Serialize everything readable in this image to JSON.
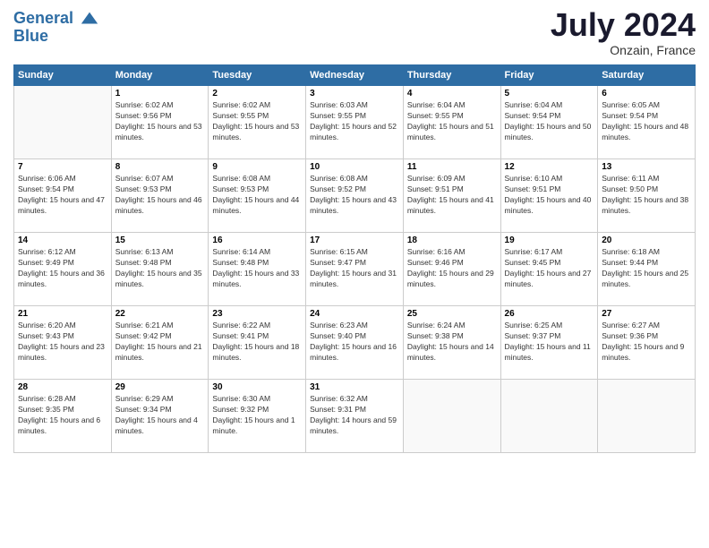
{
  "logo": {
    "line1": "General",
    "line2": "Blue"
  },
  "title": "July 2024",
  "location": "Onzain, France",
  "headers": [
    "Sunday",
    "Monday",
    "Tuesday",
    "Wednesday",
    "Thursday",
    "Friday",
    "Saturday"
  ],
  "weeks": [
    [
      {
        "day": "",
        "sunrise": "",
        "sunset": "",
        "daylight": ""
      },
      {
        "day": "1",
        "sunrise": "Sunrise: 6:02 AM",
        "sunset": "Sunset: 9:56 PM",
        "daylight": "Daylight: 15 hours and 53 minutes."
      },
      {
        "day": "2",
        "sunrise": "Sunrise: 6:02 AM",
        "sunset": "Sunset: 9:55 PM",
        "daylight": "Daylight: 15 hours and 53 minutes."
      },
      {
        "day": "3",
        "sunrise": "Sunrise: 6:03 AM",
        "sunset": "Sunset: 9:55 PM",
        "daylight": "Daylight: 15 hours and 52 minutes."
      },
      {
        "day": "4",
        "sunrise": "Sunrise: 6:04 AM",
        "sunset": "Sunset: 9:55 PM",
        "daylight": "Daylight: 15 hours and 51 minutes."
      },
      {
        "day": "5",
        "sunrise": "Sunrise: 6:04 AM",
        "sunset": "Sunset: 9:54 PM",
        "daylight": "Daylight: 15 hours and 50 minutes."
      },
      {
        "day": "6",
        "sunrise": "Sunrise: 6:05 AM",
        "sunset": "Sunset: 9:54 PM",
        "daylight": "Daylight: 15 hours and 48 minutes."
      }
    ],
    [
      {
        "day": "7",
        "sunrise": "Sunrise: 6:06 AM",
        "sunset": "Sunset: 9:54 PM",
        "daylight": "Daylight: 15 hours and 47 minutes."
      },
      {
        "day": "8",
        "sunrise": "Sunrise: 6:07 AM",
        "sunset": "Sunset: 9:53 PM",
        "daylight": "Daylight: 15 hours and 46 minutes."
      },
      {
        "day": "9",
        "sunrise": "Sunrise: 6:08 AM",
        "sunset": "Sunset: 9:53 PM",
        "daylight": "Daylight: 15 hours and 44 minutes."
      },
      {
        "day": "10",
        "sunrise": "Sunrise: 6:08 AM",
        "sunset": "Sunset: 9:52 PM",
        "daylight": "Daylight: 15 hours and 43 minutes."
      },
      {
        "day": "11",
        "sunrise": "Sunrise: 6:09 AM",
        "sunset": "Sunset: 9:51 PM",
        "daylight": "Daylight: 15 hours and 41 minutes."
      },
      {
        "day": "12",
        "sunrise": "Sunrise: 6:10 AM",
        "sunset": "Sunset: 9:51 PM",
        "daylight": "Daylight: 15 hours and 40 minutes."
      },
      {
        "day": "13",
        "sunrise": "Sunrise: 6:11 AM",
        "sunset": "Sunset: 9:50 PM",
        "daylight": "Daylight: 15 hours and 38 minutes."
      }
    ],
    [
      {
        "day": "14",
        "sunrise": "Sunrise: 6:12 AM",
        "sunset": "Sunset: 9:49 PM",
        "daylight": "Daylight: 15 hours and 36 minutes."
      },
      {
        "day": "15",
        "sunrise": "Sunrise: 6:13 AM",
        "sunset": "Sunset: 9:48 PM",
        "daylight": "Daylight: 15 hours and 35 minutes."
      },
      {
        "day": "16",
        "sunrise": "Sunrise: 6:14 AM",
        "sunset": "Sunset: 9:48 PM",
        "daylight": "Daylight: 15 hours and 33 minutes."
      },
      {
        "day": "17",
        "sunrise": "Sunrise: 6:15 AM",
        "sunset": "Sunset: 9:47 PM",
        "daylight": "Daylight: 15 hours and 31 minutes."
      },
      {
        "day": "18",
        "sunrise": "Sunrise: 6:16 AM",
        "sunset": "Sunset: 9:46 PM",
        "daylight": "Daylight: 15 hours and 29 minutes."
      },
      {
        "day": "19",
        "sunrise": "Sunrise: 6:17 AM",
        "sunset": "Sunset: 9:45 PM",
        "daylight": "Daylight: 15 hours and 27 minutes."
      },
      {
        "day": "20",
        "sunrise": "Sunrise: 6:18 AM",
        "sunset": "Sunset: 9:44 PM",
        "daylight": "Daylight: 15 hours and 25 minutes."
      }
    ],
    [
      {
        "day": "21",
        "sunrise": "Sunrise: 6:20 AM",
        "sunset": "Sunset: 9:43 PM",
        "daylight": "Daylight: 15 hours and 23 minutes."
      },
      {
        "day": "22",
        "sunrise": "Sunrise: 6:21 AM",
        "sunset": "Sunset: 9:42 PM",
        "daylight": "Daylight: 15 hours and 21 minutes."
      },
      {
        "day": "23",
        "sunrise": "Sunrise: 6:22 AM",
        "sunset": "Sunset: 9:41 PM",
        "daylight": "Daylight: 15 hours and 18 minutes."
      },
      {
        "day": "24",
        "sunrise": "Sunrise: 6:23 AM",
        "sunset": "Sunset: 9:40 PM",
        "daylight": "Daylight: 15 hours and 16 minutes."
      },
      {
        "day": "25",
        "sunrise": "Sunrise: 6:24 AM",
        "sunset": "Sunset: 9:38 PM",
        "daylight": "Daylight: 15 hours and 14 minutes."
      },
      {
        "day": "26",
        "sunrise": "Sunrise: 6:25 AM",
        "sunset": "Sunset: 9:37 PM",
        "daylight": "Daylight: 15 hours and 11 minutes."
      },
      {
        "day": "27",
        "sunrise": "Sunrise: 6:27 AM",
        "sunset": "Sunset: 9:36 PM",
        "daylight": "Daylight: 15 hours and 9 minutes."
      }
    ],
    [
      {
        "day": "28",
        "sunrise": "Sunrise: 6:28 AM",
        "sunset": "Sunset: 9:35 PM",
        "daylight": "Daylight: 15 hours and 6 minutes."
      },
      {
        "day": "29",
        "sunrise": "Sunrise: 6:29 AM",
        "sunset": "Sunset: 9:34 PM",
        "daylight": "Daylight: 15 hours and 4 minutes."
      },
      {
        "day": "30",
        "sunrise": "Sunrise: 6:30 AM",
        "sunset": "Sunset: 9:32 PM",
        "daylight": "Daylight: 15 hours and 1 minute."
      },
      {
        "day": "31",
        "sunrise": "Sunrise: 6:32 AM",
        "sunset": "Sunset: 9:31 PM",
        "daylight": "Daylight: 14 hours and 59 minutes."
      },
      {
        "day": "",
        "sunrise": "",
        "sunset": "",
        "daylight": ""
      },
      {
        "day": "",
        "sunrise": "",
        "sunset": "",
        "daylight": ""
      },
      {
        "day": "",
        "sunrise": "",
        "sunset": "",
        "daylight": ""
      }
    ]
  ]
}
